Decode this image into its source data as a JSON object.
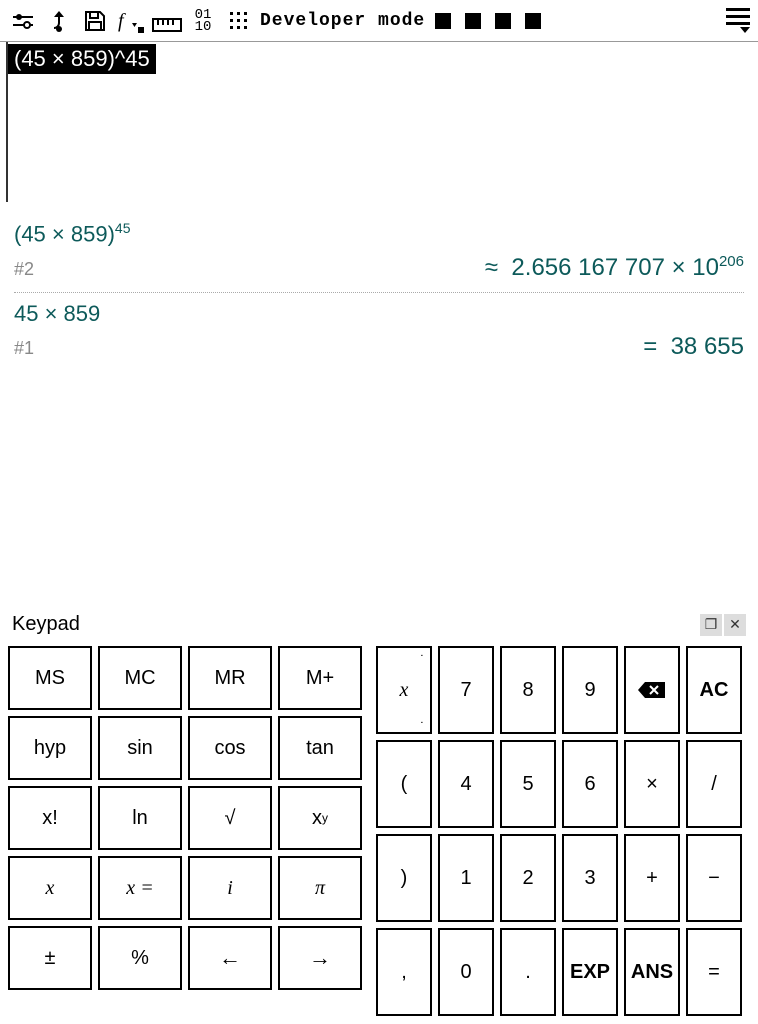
{
  "toolbar": {
    "dev_mode_label": "Developer mode"
  },
  "input": {
    "current": "(45 × 859)^45"
  },
  "history": [
    {
      "id": "#2",
      "input_html": "(45 × 859)<sup>45</sup>",
      "result_prefix": "≈",
      "result_html": "2.656 167 707 × 10<sup>206</sup>"
    },
    {
      "id": "#1",
      "input_html": "45 × 859",
      "result_prefix": "=",
      "result_html": "38 655"
    }
  ],
  "keypad": {
    "title": "Keypad",
    "left": [
      [
        "MS",
        "MC",
        "MR",
        "M+"
      ],
      [
        "hyp",
        "sin",
        "cos",
        "tan"
      ],
      [
        "x!",
        "ln",
        "√",
        "xʸ"
      ],
      [
        "x",
        "x =",
        "i",
        "π"
      ],
      [
        "±",
        "%",
        "←",
        "→"
      ]
    ],
    "right": [
      [
        "x",
        "7",
        "8",
        "9",
        "⌫",
        "AC"
      ],
      [
        "(",
        "4",
        "5",
        "6",
        "×",
        "/"
      ],
      [
        ")",
        "1",
        "2",
        "3",
        "+",
        "−"
      ],
      [
        ",",
        "0",
        ".",
        "EXP",
        "ANS",
        "="
      ]
    ]
  }
}
